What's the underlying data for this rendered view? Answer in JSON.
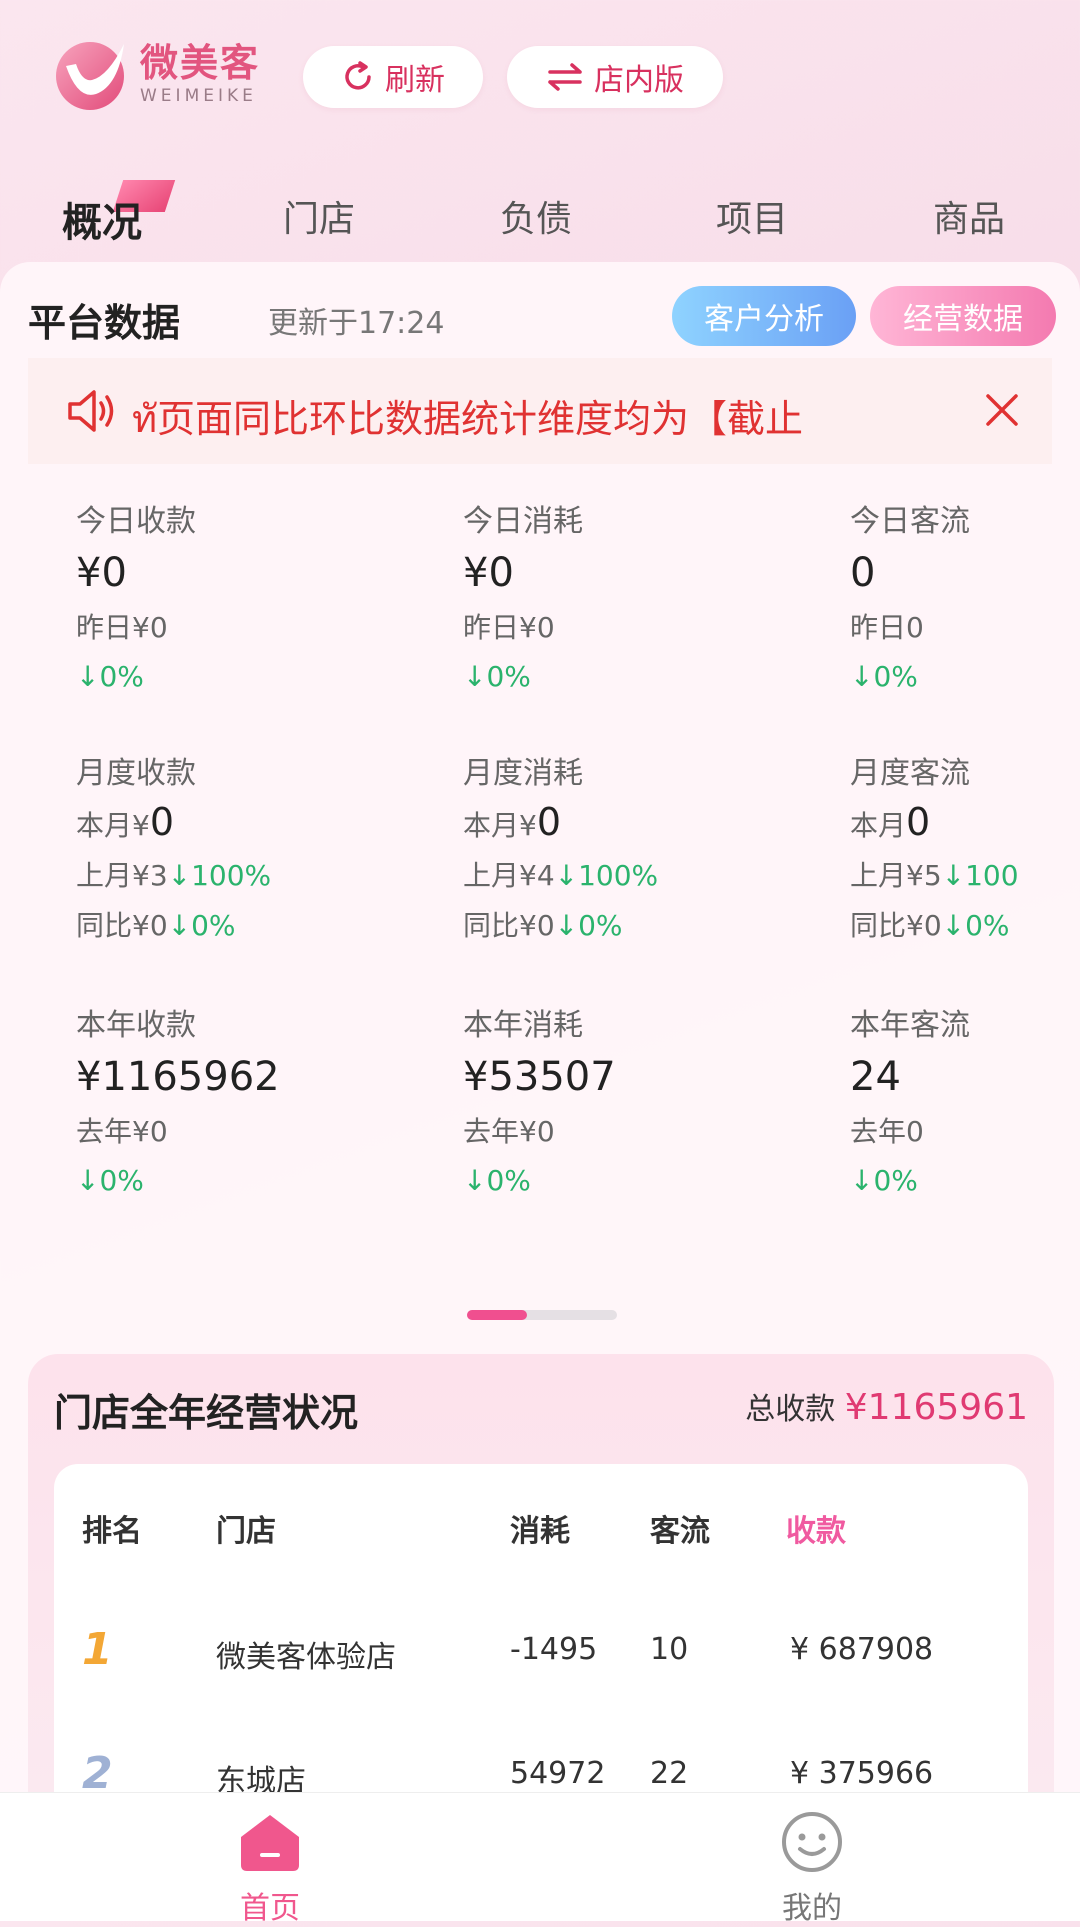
{
  "header": {
    "logo_cn": "微美客",
    "logo_en": "WEIMEIKE",
    "refresh_label": "刷新",
    "instore_label": "店内版"
  },
  "tabs": [
    {
      "label": "概况",
      "active": true
    },
    {
      "label": "门店",
      "active": false
    },
    {
      "label": "负债",
      "active": false
    },
    {
      "label": "项目",
      "active": false
    },
    {
      "label": "商品",
      "active": false
    }
  ],
  "platform": {
    "title": "平台数据",
    "updated": "更新于17:24",
    "customer_analysis": "客户分析",
    "business_data": "经营数据",
    "notice": "ทั页面同比环比数据统计维度均为【截止"
  },
  "stats": {
    "today": [
      {
        "label": "今日收款",
        "value": "¥0",
        "prev": "昨日¥0",
        "change": "↓0%"
      },
      {
        "label": "今日消耗",
        "value": "¥0",
        "prev": "昨日¥0",
        "change": "↓0%"
      },
      {
        "label": "今日客流",
        "value": "0",
        "prev": "昨日0",
        "change": "↓0%"
      }
    ],
    "month": [
      {
        "label": "月度收款",
        "cur_prefix": "本月¥",
        "cur_val": "0",
        "last": "上月¥3",
        "last_change": "↓100%",
        "yoy": "同比¥0",
        "yoy_change": "↓0%"
      },
      {
        "label": "月度消耗",
        "cur_prefix": "本月¥",
        "cur_val": "0",
        "last": "上月¥4",
        "last_change": "↓100%",
        "yoy": "同比¥0",
        "yoy_change": "↓0%"
      },
      {
        "label": "月度客流",
        "cur_prefix": "本月",
        "cur_val": "0",
        "last": "上月¥5",
        "last_change": "↓100",
        "yoy": "同比¥0",
        "yoy_change": "↓0%"
      }
    ],
    "year": [
      {
        "label": "本年收款",
        "value": "¥1165962",
        "prev": "去年¥0",
        "change": "↓0%"
      },
      {
        "label": "本年消耗",
        "value": "¥53507",
        "prev": "去年¥0",
        "change": "↓0%"
      },
      {
        "label": "本年客流",
        "value": "24",
        "prev": "去年0",
        "change": "↓0%"
      }
    ]
  },
  "store_section": {
    "title": "门店全年经营状况",
    "total_label": "总收款",
    "total_value": "¥1165961",
    "headers": {
      "rank": "排名",
      "store": "门店",
      "consume": "消耗",
      "traffic": "客流",
      "revenue": "收款"
    },
    "rows": [
      {
        "rank": "1",
        "store": "微美客体验店",
        "consume": "-1495",
        "traffic": "10",
        "revenue": "¥ 687908"
      },
      {
        "rank": "2",
        "store": "东城店",
        "consume": "54972",
        "traffic": "22",
        "revenue": "¥ 375966"
      }
    ]
  },
  "bottom_nav": {
    "home": "首页",
    "mine": "我的"
  },
  "colors": {
    "brand": "#e2557f",
    "accent_red": "#d8315f",
    "up_down_green": "#2bb36d",
    "revenue_pink": "#e03a72",
    "home_active": "#f0578d"
  }
}
